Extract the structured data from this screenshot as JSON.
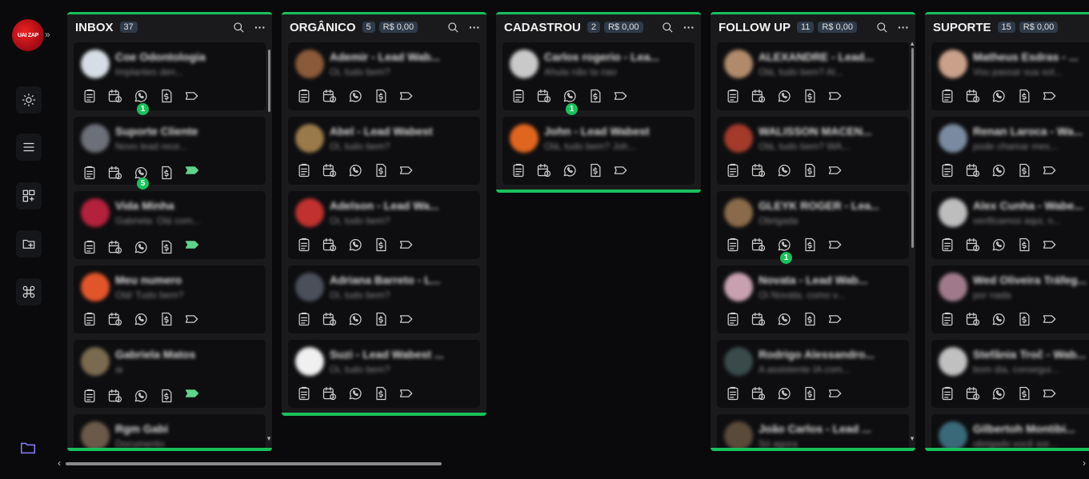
{
  "logo_text": "UAI ZAP",
  "sidebar": {
    "items": [
      {
        "name": "sun-icon"
      },
      {
        "name": "menu-icon"
      },
      {
        "name": "board-add-icon"
      },
      {
        "name": "folder-add-icon"
      },
      {
        "name": "command-icon"
      }
    ]
  },
  "columns": [
    {
      "title": "INBOX",
      "count": "37",
      "money": "",
      "cards": [
        {
          "name": "Coe Odontologia",
          "msg": "Implantes den...",
          "avatar": "#d7dde6",
          "tag": "outline",
          "badge": "1"
        },
        {
          "name": "Suporte Cliente",
          "msg": "Novo lead rece...",
          "avatar": "#6d6f79",
          "tag": "green",
          "badge": "5"
        },
        {
          "name": "Vida Minha",
          "msg": "Gabriela: Olá com...",
          "avatar": "#b3213c",
          "tag": "green",
          "badge": ""
        },
        {
          "name": "Meu numero",
          "msg": "Olá! Tudo bem?",
          "avatar": "#e2552b",
          "tag": "outline",
          "badge": ""
        },
        {
          "name": "Gabriela Matos",
          "msg": "ai",
          "avatar": "#7a6a4f",
          "tag": "green",
          "badge": ""
        },
        {
          "name": "Rgm Gabi",
          "msg": "Documento",
          "avatar": "#6b5a4a",
          "tag": "outline",
          "badge": ""
        }
      ]
    },
    {
      "title": "ORGÂNICO",
      "count": "5",
      "money": "R$ 0,00",
      "cards": [
        {
          "name": "Ademir - Lead Wab...",
          "msg": "Oi, tudo bem?",
          "avatar": "#8b5a3a",
          "tag": "outline",
          "badge": ""
        },
        {
          "name": "Abel - Lead Wabest",
          "msg": "Oi, tudo bem?",
          "avatar": "#9a7a4a",
          "tag": "outline",
          "badge": ""
        },
        {
          "name": "Adelson - Lead Wa...",
          "msg": "Oi, tudo bem?",
          "avatar": "#c0312f",
          "tag": "outline",
          "badge": ""
        },
        {
          "name": "Adriana Barreto - L...",
          "msg": "Oi, tudo bem?",
          "avatar": "#4a4f5a",
          "tag": "outline",
          "badge": ""
        },
        {
          "name": "Suzi - Lead Wabest ...",
          "msg": "Oi, tudo bem?",
          "avatar": "#f0f0f0",
          "tag": "outline",
          "badge": ""
        }
      ]
    },
    {
      "title": "CADASTROU",
      "count": "2",
      "money": "R$ 0,00",
      "cards": [
        {
          "name": "Carlos rogerio - Lea...",
          "msg": "Ahula não ta nao",
          "avatar": "#c9c9c9",
          "tag": "outline",
          "badge": "1"
        },
        {
          "name": "John - Lead Wabest",
          "msg": "Olá, tudo bem? Joh...",
          "avatar": "#e0651f",
          "tag": "outline",
          "badge": ""
        }
      ]
    },
    {
      "title": "FOLLOW UP",
      "count": "11",
      "money": "R$ 0,00",
      "cards": [
        {
          "name": "ALEXANDRE - Lead...",
          "msg": "Olá, tudo bem? Al...",
          "avatar": "#b08a6a",
          "tag": "outline",
          "badge": ""
        },
        {
          "name": "WALISSON MACEN...",
          "msg": "Olá, tudo bem? WA...",
          "avatar": "#a33a2a",
          "tag": "outline",
          "badge": ""
        },
        {
          "name": "GLEYK ROGER - Lea...",
          "msg": "Obrigada",
          "avatar": "#8a6a4a",
          "tag": "outline",
          "badge": "1"
        },
        {
          "name": "Novata - Lead Wab...",
          "msg": "Oi Novata, como v...",
          "avatar": "#c9a0b0",
          "tag": "outline",
          "badge": ""
        },
        {
          "name": "Rodrigo Alessandro...",
          "msg": "A assistente IA com...",
          "avatar": "#3a4a4a",
          "tag": "outline",
          "badge": ""
        },
        {
          "name": "João Carlos - Lead ...",
          "msg": "Só agora",
          "avatar": "#5a4a3a",
          "tag": "outline",
          "badge": ""
        }
      ]
    },
    {
      "title": "SUPORTE",
      "count": "15",
      "money": "R$ 0,00",
      "cards": [
        {
          "name": "Matheus Esdras - ...",
          "msg": "Vou passar sua sol...",
          "avatar": "#c9a08a",
          "tag": "outline",
          "badge": ""
        },
        {
          "name": "Renan Laroca - Wa...",
          "msg": "pode chamar mes...",
          "avatar": "#7a8aa0",
          "tag": "outline",
          "badge": ""
        },
        {
          "name": "Alex Cunha - Wabe...",
          "msg": "verificamos aqui, n...",
          "avatar": "#bdbdbd",
          "tag": "outline",
          "badge": ""
        },
        {
          "name": "Wed Oliveira Tráfeg...",
          "msg": "por nada",
          "avatar": "#a07a8a",
          "tag": "outline",
          "badge": ""
        },
        {
          "name": "Stefânia Troč - Wab...",
          "msg": "bom dia, consegui...",
          "avatar": "#c0c0c0",
          "tag": "outline",
          "badge": ""
        },
        {
          "name": "Gilbertoh Montibi...",
          "msg": "obrigado você sor...",
          "avatar": "#3a6a7a",
          "tag": "outline",
          "badge": ""
        }
      ]
    }
  ]
}
